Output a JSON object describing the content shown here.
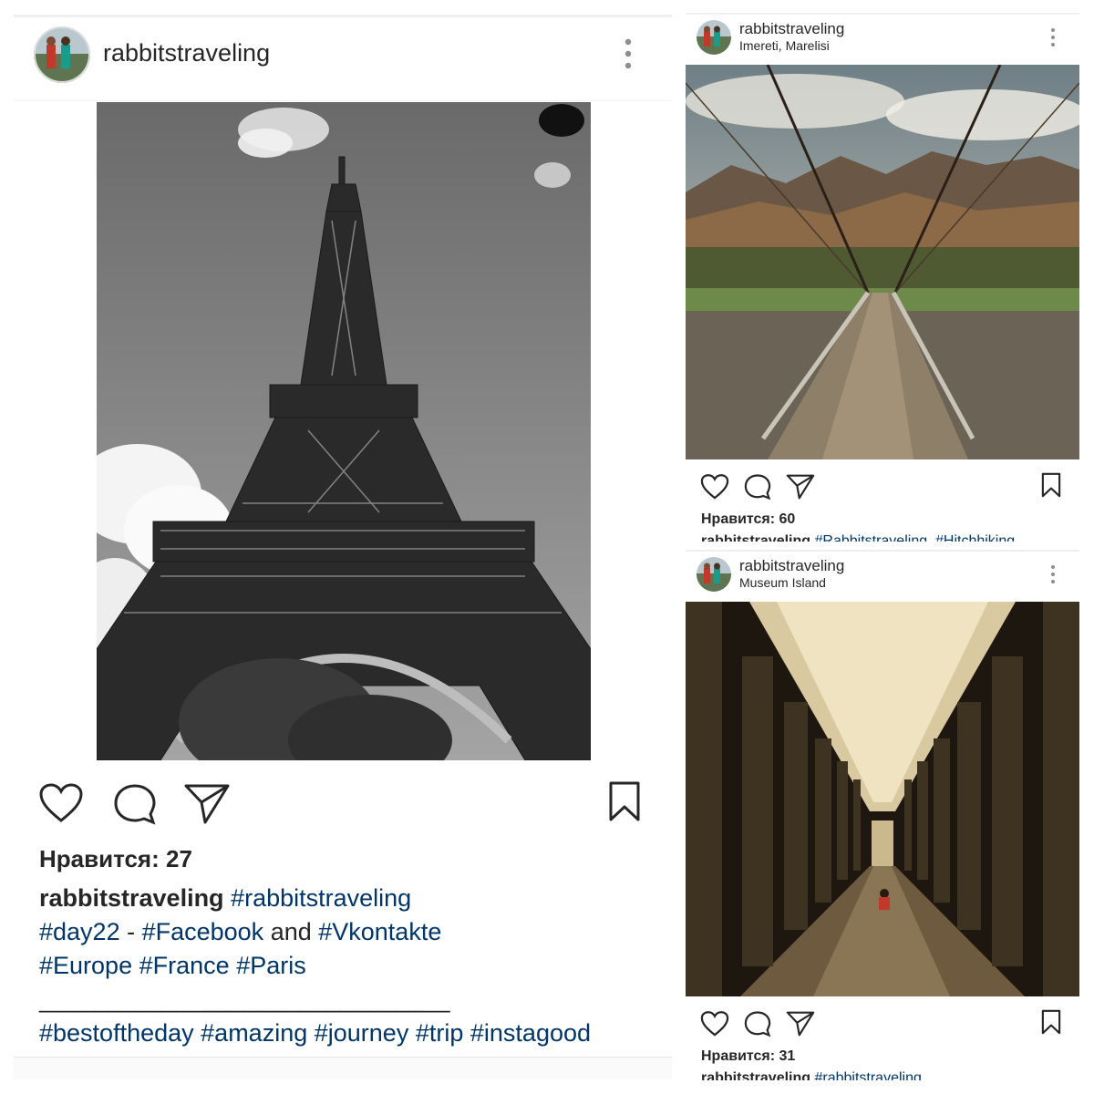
{
  "posts": {
    "main": {
      "username": "rabbitstraveling",
      "likes": "Нравится: 27",
      "caption": {
        "user": "rabbitstraveling",
        "line1_tag": "#rabbitstraveling",
        "line2_tag1": "#day22",
        "line2_sep": " - ",
        "line2_tag2": "#Facebook",
        "line2_and": " and ",
        "line2_tag3": "#Vkontakte",
        "line3_tag1": "#Europe",
        "line3_tag2": "#France",
        "line3_tag3": "#Paris",
        "divider": "______________________________",
        "line5_tag1": "#bestoftheday",
        "line5_tag2": "#amazing",
        "line5_tag3": "#journey",
        "line5_tag4": "#trip",
        "line5_tag5": "#instagood"
      },
      "photo_icon": "eiffel-tower-photo"
    },
    "bridge": {
      "username": "rabbitstraveling",
      "location": "Imereti, Marelisi",
      "likes": "Нравится: 60",
      "caption": {
        "user": "rabbitstraveling",
        "tag1": "#Rabbitstraveling",
        "tag2": "#Hitchhiking"
      },
      "photo_icon": "suspension-bridge-photo"
    },
    "museum": {
      "username": "rabbitstraveling",
      "location": "Museum Island",
      "likes": "Нравится: 31",
      "caption": {
        "user": "rabbitstraveling",
        "tag1": "#rabbitstraveling"
      },
      "photo_icon": "colonnade-photo"
    }
  },
  "icons": {
    "like": "heart-icon",
    "comment": "comment-icon",
    "share": "send-icon",
    "save": "bookmark-icon",
    "more": "more-vertical-icon"
  },
  "colors": {
    "hashtag": "#003569",
    "text": "#262626",
    "divider": "#efefef"
  }
}
